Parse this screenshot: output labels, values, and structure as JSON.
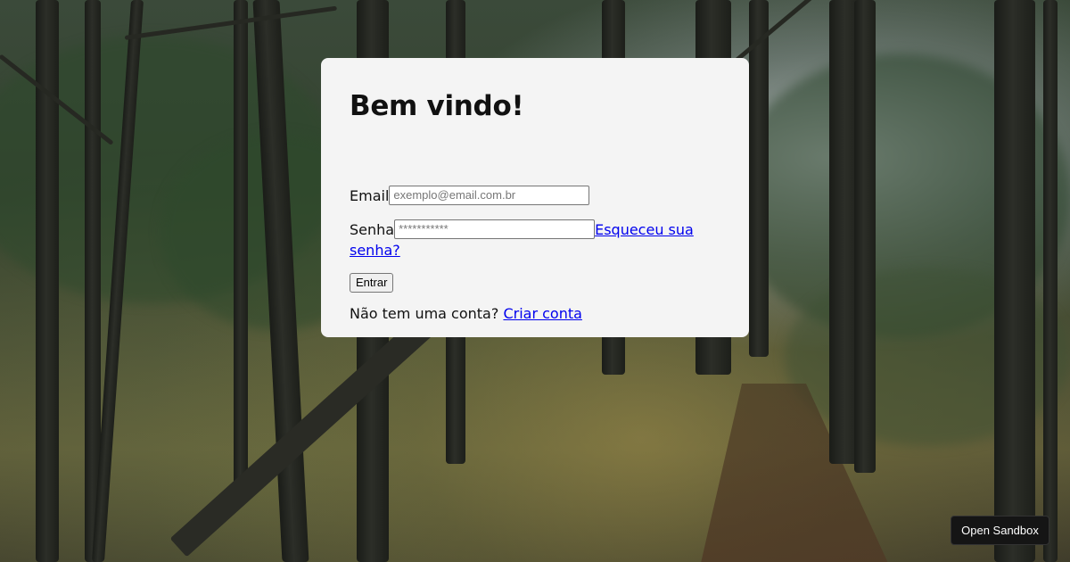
{
  "page": {
    "background": "forest-photo"
  },
  "login": {
    "title": "Bem vindo!",
    "email_label": "Email",
    "email_placeholder": "exemplo@email.com.br",
    "password_label": "Senha",
    "password_placeholder": "***********",
    "forgot_link": "Esqueceu sua senha?",
    "submit_label": "Entrar",
    "signup_prompt": "Não tem uma conta?",
    "signup_link": "Criar conta"
  },
  "sandbox": {
    "button_label": "Open Sandbox"
  },
  "colors": {
    "card_bg": "#f4f4f4",
    "link": "#0000ee",
    "sandbox_bg": "#151515"
  }
}
